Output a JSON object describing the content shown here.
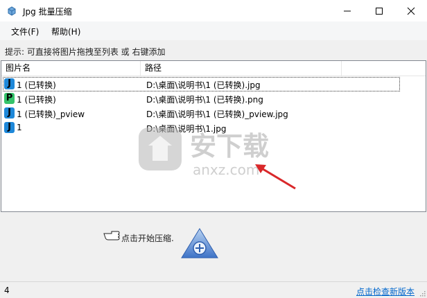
{
  "window": {
    "title": "Jpg 批量压缩"
  },
  "menu": [
    {
      "label": "文件(F)"
    },
    {
      "label": "帮助(H)"
    }
  ],
  "hint": "提示: 可直接将图片拖拽至列表 或 右键添加",
  "list": {
    "columns": [
      "图片名",
      "路径"
    ],
    "rows": [
      {
        "icon": "J",
        "icon_color": "#1e88d9",
        "name": "1 (已转换)",
        "path": "D:\\桌面\\说明书\\1 (已转换).jpg"
      },
      {
        "icon": "P",
        "icon_color": "#34c36b",
        "name": "1 (已转换)",
        "path": "D:\\桌面\\说明书\\1 (已转换).png"
      },
      {
        "icon": "J",
        "icon_color": "#1e88d9",
        "name": "1 (已转换)_pview",
        "path": "D:\\桌面\\说明书\\1 (已转换)_pview.jpg"
      },
      {
        "icon": "J",
        "icon_color": "#1e88d9",
        "name": "1",
        "path": "D:\\桌面\\说明书\\1.jpg"
      }
    ]
  },
  "compress_label": "点击开始压缩.",
  "status": {
    "count": "4",
    "update_link": "点击检查新版本"
  },
  "watermark": {
    "text": "安下载",
    "subtext": "anxz.com"
  }
}
